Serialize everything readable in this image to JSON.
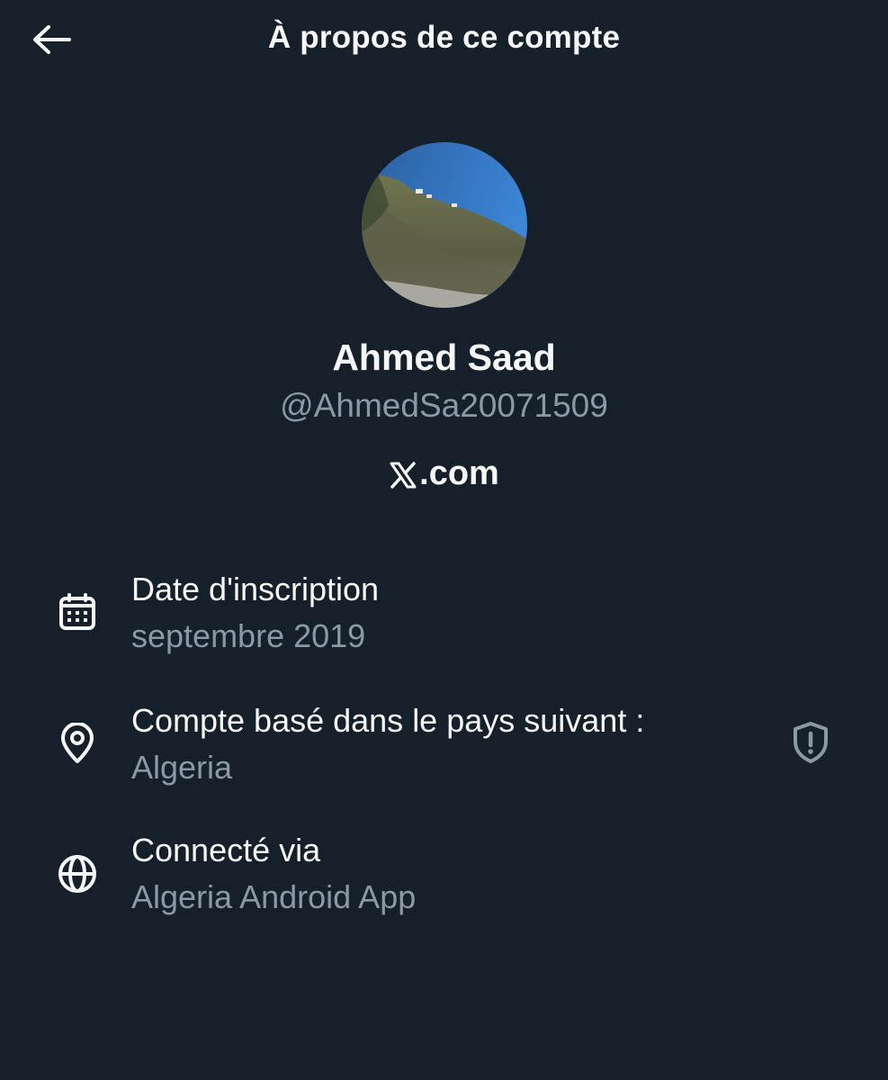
{
  "header": {
    "title": "À propos de ce compte",
    "back_icon": "arrow-left-icon"
  },
  "profile": {
    "name": "Ahmed Saad",
    "handle": "@AhmedSa20071509",
    "brand_text": ".com",
    "brand_icon": "x-logo-icon"
  },
  "details": {
    "joined": {
      "icon": "calendar-icon",
      "label": "Date d'inscription",
      "value": "septembre 2019"
    },
    "country": {
      "icon": "location-pin-icon",
      "label": "Compte basé dans le pays suivant :",
      "value": "Algeria",
      "info_icon": "shield-alert-icon"
    },
    "connected": {
      "icon": "globe-icon",
      "label": "Connecté via",
      "value": "Algeria Android App"
    }
  },
  "colors": {
    "background": "#15202b",
    "primary_text": "#f7f9f9",
    "secondary_text": "#8b98a5"
  }
}
